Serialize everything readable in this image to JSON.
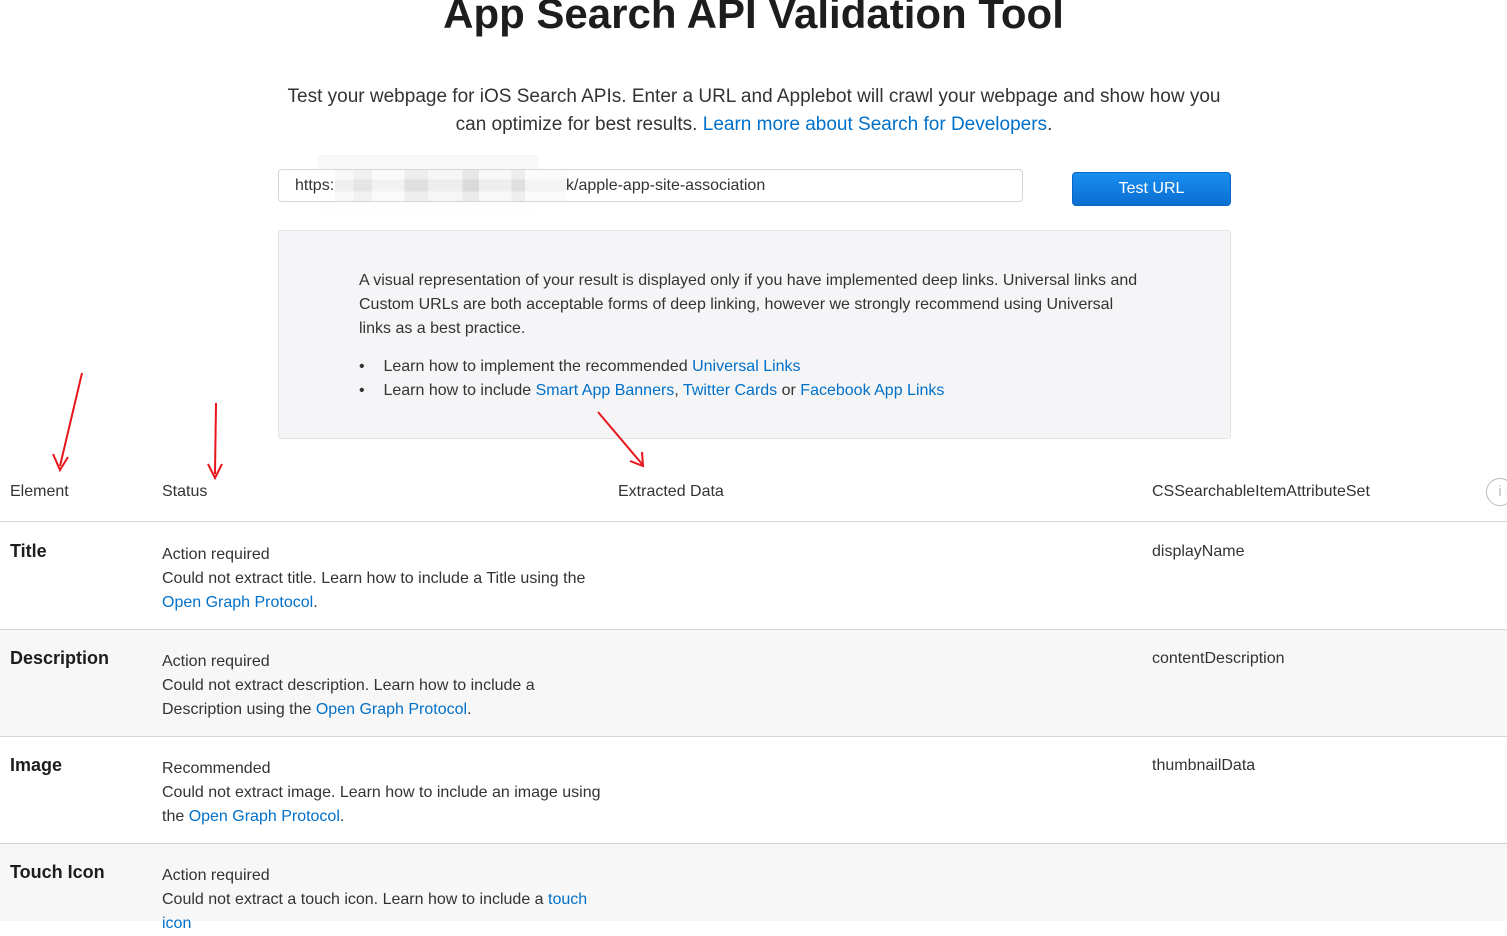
{
  "header": {
    "title": "App Search API Validation Tool",
    "intro_text": "Test your webpage for iOS Search APIs. Enter a URL and Applebot will crawl your webpage and show how you can optimize for best results.",
    "intro_link": "Learn more about Search for Developers",
    "intro_end": "."
  },
  "url_form": {
    "url_prefix": "https:",
    "url_suffix": "k/apple-app-site-association",
    "test_button": "Test URL"
  },
  "info_box": {
    "text": "A visual representation of your result is displayed only if you have implemented deep links. Universal links and Custom URLs are both acceptable forms of deep linking, however we strongly recommend using Universal links as a best practice.",
    "bullet1_text": "Learn how to implement the recommended ",
    "bullet1_link": "Universal Links",
    "bullet2_text": "Learn how to include ",
    "bullet2_link1": "Smart App Banners",
    "bullet2_sep": ", ",
    "bullet2_link2": "Twitter Cards",
    "bullet2_or": " or ",
    "bullet2_link3": "Facebook App Links"
  },
  "table": {
    "columns": [
      "Element",
      "Status",
      "Extracted Data",
      "CSSearchableItemAttributeSet"
    ],
    "info_icon": "i",
    "rows": [
      {
        "element": "Title",
        "status": "Action required",
        "message": "Could not extract title. Learn how to include a Title using the ",
        "link": "Open Graph Protocol",
        "end": ".",
        "attribute": "displayName"
      },
      {
        "element": "Description",
        "status": "Action required",
        "message": "Could not extract description. Learn how to include a Description using the ",
        "link": "Open Graph Protocol",
        "end": ".",
        "attribute": "contentDescription"
      },
      {
        "element": "Image",
        "status": "Recommended",
        "message": "Could not extract image. Learn how to include an image using the ",
        "link": "Open Graph Protocol",
        "end": ".",
        "attribute": "thumbnailData"
      },
      {
        "element": "Touch Icon",
        "status": "Action required",
        "message": "Could not extract a touch icon. Learn how to include a ",
        "link": "touch icon",
        "end": "",
        "attribute": ""
      }
    ]
  },
  "colors": {
    "link": "#0070c9",
    "button": "#0a6fd1",
    "annotation_arrow": "#e8151b"
  }
}
